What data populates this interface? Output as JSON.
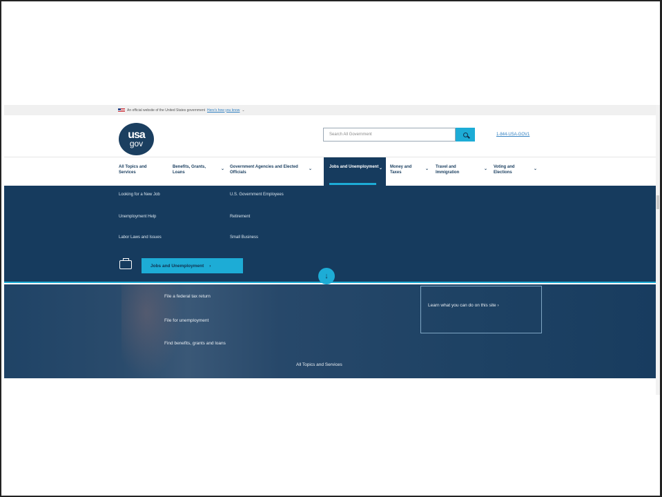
{
  "gov_banner": {
    "text": "An official website of the United States government",
    "link": "Here's how you know"
  },
  "header": {
    "logo_usa": "usa",
    "logo_gov": "gov",
    "search_placeholder": "Search All Government",
    "phone": "1-844-USA-GOV1"
  },
  "nav": {
    "items": [
      {
        "label": "All Topics and Services"
      },
      {
        "label": "Benefits, Grants, Loans"
      },
      {
        "label": "Government Agencies and Elected Officials"
      },
      {
        "label": "Jobs and Unemployment"
      },
      {
        "label": "Money and Taxes"
      },
      {
        "label": "Travel and Immigration"
      },
      {
        "label": "Voting and Elections"
      }
    ]
  },
  "mega": {
    "col1": [
      "Looking for a New Job",
      "Unemployment Help",
      "Labor Laws and Issues"
    ],
    "col2": [
      "U.S. Government Employees",
      "Retirement",
      "Small Business"
    ],
    "cta": "Jobs and Unemployment"
  },
  "hero": {
    "links": [
      "File a federal tax return",
      "File for unemployment",
      "Find benefits, grants and loans"
    ],
    "learn": "Learn what you can do on this site",
    "all_topics": "All Topics and Services"
  },
  "icons": {
    "down": "arrow-down-icon",
    "search": "search-icon",
    "briefcase": "briefcase-icon"
  },
  "colors": {
    "navy": "#163b5e",
    "accent": "#1dacd6"
  }
}
